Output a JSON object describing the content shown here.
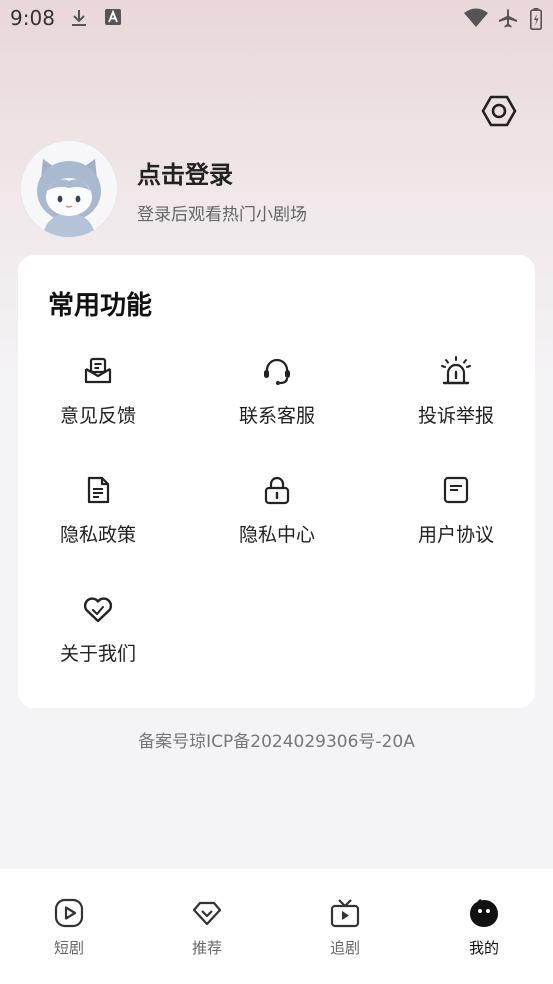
{
  "status_bar": {
    "time": "9:08",
    "left_icons": [
      "download-icon",
      "font-a-icon"
    ],
    "right_icons": [
      "wifi-icon",
      "airplane-icon",
      "battery-icon"
    ]
  },
  "header": {
    "settings_icon": "settings-hexagon-icon",
    "avatar": "avatar-cat-hood",
    "login_title": "点击登录",
    "login_subtitle": "登录后观看热门小剧场"
  },
  "functions": {
    "title": "常用功能",
    "items": [
      {
        "label": "意见反馈",
        "icon": "feedback-mail-icon"
      },
      {
        "label": "联系客服",
        "icon": "headset-icon"
      },
      {
        "label": "投诉举报",
        "icon": "alarm-light-icon"
      },
      {
        "label": "隐私政策",
        "icon": "document-icon"
      },
      {
        "label": "隐私中心",
        "icon": "lock-icon"
      },
      {
        "label": "用户协议",
        "icon": "agreement-icon"
      },
      {
        "label": "关于我们",
        "icon": "heart-icon"
      }
    ]
  },
  "footer": {
    "icp": "备案号琼ICP备2024029306号-20A"
  },
  "bottom_nav": {
    "items": [
      {
        "label": "短剧",
        "icon": "play-icon",
        "active": false
      },
      {
        "label": "推荐",
        "icon": "diamond-icon",
        "active": false
      },
      {
        "label": "追剧",
        "icon": "tv-icon",
        "active": false
      },
      {
        "label": "我的",
        "icon": "profile-face-icon",
        "active": true
      }
    ]
  },
  "colors": {
    "accent": "#111111",
    "inactive": "#666666",
    "card": "#ffffff",
    "bg_top": "#e9d7d9"
  }
}
